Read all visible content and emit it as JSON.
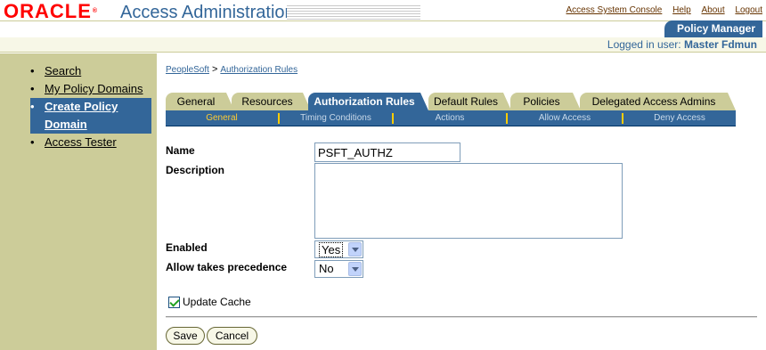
{
  "header": {
    "brand": "ORACLE",
    "title": "Access Administration",
    "links": [
      "Access System Console",
      "Help",
      "About",
      "Logout"
    ],
    "section_tab": "Policy Manager",
    "logged_in_label": "Logged in user:",
    "logged_in_user": "Master Fdmun"
  },
  "sidebar": {
    "items": [
      {
        "label": "Search",
        "active": false
      },
      {
        "label": "My Policy Domains",
        "active": false
      },
      {
        "label": "Create Policy Domain",
        "active": true
      },
      {
        "label": "Access Tester",
        "active": false
      }
    ]
  },
  "breadcrumb": {
    "items": [
      "PeopleSoft",
      "Authorization Rules"
    ],
    "separator": ">"
  },
  "tabs": [
    {
      "label": "General"
    },
    {
      "label": "Resources"
    },
    {
      "label": "Authorization Rules"
    },
    {
      "label": "Default Rules"
    },
    {
      "label": "Policies"
    },
    {
      "label": "Delegated Access Admins"
    }
  ],
  "active_tab": "Authorization Rules",
  "subtabs": [
    "General",
    "Timing Conditions",
    "Actions",
    "Allow Access",
    "Deny Access"
  ],
  "active_subtab": "General",
  "form": {
    "name_label": "Name",
    "name_value": "PSFT_AUTHZ",
    "description_label": "Description",
    "description_value": "",
    "enabled_label": "Enabled",
    "enabled_value": "Yes",
    "allow_label": "Allow takes precedence",
    "allow_value": "No",
    "update_cache_label": "Update Cache",
    "update_cache_checked": true
  },
  "buttons": {
    "save": "Save",
    "cancel": "Cancel"
  },
  "colors": {
    "brand_red": "#ff0000",
    "accent_blue": "#336699",
    "sidebar_tan": "#cccc99",
    "subtab_active": "#ffcc33"
  }
}
